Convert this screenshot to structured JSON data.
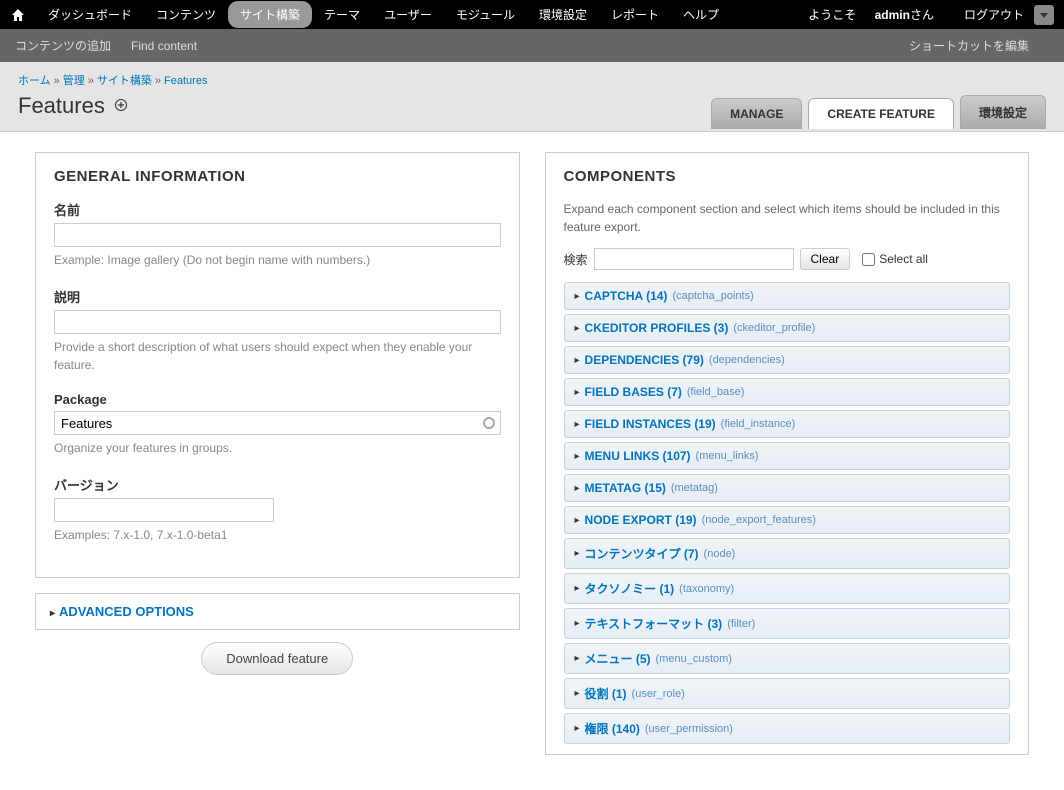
{
  "topbar": {
    "menu": [
      "ダッシュボード",
      "コンテンツ",
      "サイト構築",
      "テーマ",
      "ユーザー",
      "モジュール",
      "環境設定",
      "レポート",
      "ヘルプ"
    ],
    "active_index": 2,
    "welcome_prefix": "ようこそ ",
    "welcome_user": "admin",
    "welcome_suffix": "さん",
    "logout": "ログアウト"
  },
  "subbar": {
    "add_content": "コンテンツの追加",
    "find_content": "Find content",
    "edit_shortcuts": "ショートカットを編集"
  },
  "breadcrumb": {
    "items": [
      "ホーム",
      "管理",
      "サイト構築",
      "Features"
    ]
  },
  "page_title": "Features",
  "tabs": {
    "manage": "MANAGE",
    "create": "CREATE FEATURE",
    "settings": "環境設定"
  },
  "general": {
    "heading": "GENERAL INFORMATION",
    "name_label": "名前",
    "name_desc": "Example: Image gallery (Do not begin name with numbers.)",
    "desc_label": "説明",
    "desc_desc": "Provide a short description of what users should expect when they enable your feature.",
    "package_label": "Package",
    "package_value": "Features",
    "package_desc": "Organize your features in groups.",
    "version_label": "バージョン",
    "version_desc": "Examples: 7.x-1.0, 7.x-1.0-beta1"
  },
  "advanced": {
    "label": "ADVANCED OPTIONS"
  },
  "download_btn": "Download feature",
  "components": {
    "heading": "COMPONENTS",
    "desc": "Expand each component section and select which items should be included in this feature export.",
    "search_label": "検索",
    "clear": "Clear",
    "select_all": "Select all",
    "items": [
      {
        "name": "CAPTCHA (14)",
        "machine": "(captcha_points)"
      },
      {
        "name": "CKEDITOR PROFILES (3)",
        "machine": "(ckeditor_profile)"
      },
      {
        "name": "DEPENDENCIES (79)",
        "machine": "(dependencies)"
      },
      {
        "name": "FIELD BASES (7)",
        "machine": "(field_base)"
      },
      {
        "name": "FIELD INSTANCES (19)",
        "machine": "(field_instance)"
      },
      {
        "name": "MENU LINKS (107)",
        "machine": "(menu_links)"
      },
      {
        "name": "METATAG (15)",
        "machine": "(metatag)"
      },
      {
        "name": "NODE EXPORT (19)",
        "machine": "(node_export_features)"
      },
      {
        "name": "コンテンツタイプ (7)",
        "machine": "(node)"
      },
      {
        "name": "タクソノミー (1)",
        "machine": "(taxonomy)"
      },
      {
        "name": "テキストフォーマット (3)",
        "machine": "(filter)"
      },
      {
        "name": "メニュー (5)",
        "machine": "(menu_custom)"
      },
      {
        "name": "役割 (1)",
        "machine": "(user_role)"
      },
      {
        "name": "権限 (140)",
        "machine": "(user_permission)"
      }
    ]
  }
}
